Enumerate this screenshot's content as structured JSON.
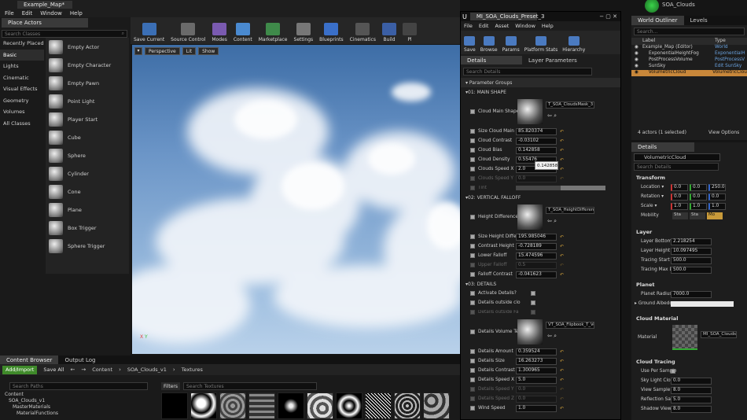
{
  "main_menu": [
    "File",
    "Edit",
    "Window",
    "Help"
  ],
  "doc_tab": "Example_Map*",
  "place_actors": {
    "tab": "Place Actors",
    "search_placeholder": "Search Classes",
    "categories": [
      "Recently Placed",
      "Basic",
      "Lights",
      "Cinematic",
      "Visual Effects",
      "Geometry",
      "Volumes",
      "All Classes"
    ],
    "selected_category": "Basic",
    "items": [
      "Empty Actor",
      "Empty Character",
      "Empty Pawn",
      "Point Light",
      "Player Start",
      "Cube",
      "Sphere",
      "Cylinder",
      "Cone",
      "Plane",
      "Box Trigger",
      "Sphere Trigger"
    ]
  },
  "toolbar": [
    "Save Current",
    "Source Control",
    "Modes",
    "Content",
    "Marketplace",
    "Settings",
    "Blueprints",
    "Cinematics",
    "Build",
    "Pl"
  ],
  "viewport": {
    "perspective": "Perspective",
    "lit": "Lit",
    "show": "Show",
    "axis_x": "X",
    "axis_y": "Y"
  },
  "content_browser": {
    "tabs": [
      "Content Browser",
      "Output Log"
    ],
    "add_import": "Add/Import",
    "save_all": "Save All",
    "path": [
      "Content",
      "SOA_Clouds_v1",
      "Textures"
    ],
    "search_paths": "Search Paths",
    "filters": "Filters",
    "search_textures": "Search Textures",
    "tree": [
      "Content",
      "SOA_Clouds_v1",
      "MasterMaterials",
      "MaterialFunctions"
    ]
  },
  "material_editor": {
    "tab": "MI_SOA_Clouds_Preset_3",
    "menu": [
      "File",
      "Edit",
      "Asset",
      "Window",
      "Help"
    ],
    "tools": [
      "Save",
      "Browse",
      "Params",
      "Platform Stats",
      "Hierarchy"
    ],
    "subtabs": [
      "Details",
      "Layer Parameters"
    ],
    "search": "Search Details",
    "parameter_groups": "Parameter Groups",
    "groups": [
      {
        "title": "01: MAIN SHAPE",
        "rows": [
          {
            "label": "Cloud Main Shape",
            "tex": "T_SOA_CloudsMask_3",
            "kind": "tex"
          },
          {
            "label": "Size Cloud Main S",
            "value": "85.820374"
          },
          {
            "label": "Cloud Contrast",
            "value": "-0.03102"
          },
          {
            "label": "Cloud Bias",
            "value": "0.142858"
          },
          {
            "label": "Cloud Density",
            "value": "0.55476"
          },
          {
            "label": "Clouds Speed X",
            "value": "2.0"
          },
          {
            "label": "Clouds Speed Y",
            "value": "0.0",
            "off": true
          },
          {
            "label": "Tint",
            "kind": "tint",
            "off": true
          }
        ]
      },
      {
        "title": "02: VERTICAL FALLOFF",
        "rows": [
          {
            "label": "Height Difference",
            "tex": "T_SOA_HeightDifference_1",
            "kind": "tex"
          },
          {
            "label": "Size Height Differ",
            "value": "195.985046"
          },
          {
            "label": "Contrast Height Di",
            "value": "-0.728189"
          },
          {
            "label": "Lower Falloff",
            "value": "15.474596"
          },
          {
            "label": "Upper Falloff",
            "value": "0.5",
            "off": true
          },
          {
            "label": "Falloff Contrast",
            "value": "-0.041623"
          }
        ]
      },
      {
        "title": "03: DETAILS",
        "rows": [
          {
            "label": "Activate Details?",
            "kind": "bool"
          },
          {
            "label": "Details outside clo",
            "kind": "bool"
          },
          {
            "label": "Details outside Fa",
            "kind": "bool",
            "off": true
          },
          {
            "label": "Details Volume Te",
            "tex": "VT_SOA_Flipbook_T_Volum",
            "kind": "tex"
          },
          {
            "label": "Details Amount",
            "value": "0.359524"
          },
          {
            "label": "Details Size",
            "value": "16.263273"
          },
          {
            "label": "Details Contrast",
            "value": "1.300965"
          },
          {
            "label": "Details Speed X",
            "value": "5.0"
          },
          {
            "label": "Details Speed Y",
            "value": "0.0",
            "off": true
          },
          {
            "label": "Details Speed Z",
            "value": "0.0",
            "off": true
          },
          {
            "label": "Wind Speed",
            "value": "1.0"
          }
        ]
      }
    ],
    "tooltip": "0.142858"
  },
  "user": "SOA_Clouds",
  "world_outliner": {
    "tabs": [
      "World Outliner",
      "Levels"
    ],
    "search": "Search...",
    "col_label": "Label",
    "col_type": "Type",
    "rows": [
      {
        "label": "Example_Map (Editor)",
        "type": "World"
      },
      {
        "label": "ExponentialHeightFog",
        "type": "ExponentialH"
      },
      {
        "label": "PostProcessVolume",
        "type": "PostProcessV"
      },
      {
        "label": "SunSky",
        "type": "Edit SunSky"
      },
      {
        "label": "VolumetricCloud",
        "type": "VolumetricClou"
      }
    ],
    "status": "4 actors (1 selected)",
    "view_options": "View Options"
  },
  "details": {
    "tab": "Details",
    "name": "VolumetricCloud",
    "search": "Search Details",
    "transform": "Transform",
    "location": [
      "0.0",
      "0.0",
      "250.0"
    ],
    "rotation": [
      "0.0",
      "0.0",
      "0.0"
    ],
    "scale": [
      "1.0",
      "1.0",
      "1.0"
    ],
    "mobility": [
      "Sta",
      "Sta",
      "Mo"
    ],
    "layer": "Layer",
    "layer_rows": [
      {
        "label": "Layer Bottom Al",
        "value": "2.218254"
      },
      {
        "label": "Layer Height",
        "value": "10.097495"
      },
      {
        "label": "Tracing Start M",
        "value": "500.0"
      },
      {
        "label": "Tracing Max Dis",
        "value": "500.0"
      }
    ],
    "planet": "Planet",
    "planet_radius": "7000.0",
    "ground_albedo": "Ground Albedo",
    "cloud_material": "Cloud Material",
    "material_label": "Material",
    "material_value": "MI_SOA_Clouds",
    "cloud_tracing": "Cloud Tracing",
    "tracing_rows": [
      {
        "label": "Use Per Sample",
        "value": ""
      },
      {
        "label": "Sky Light Cloud",
        "value": "0.0"
      },
      {
        "label": "View Sample Co",
        "value": "8.0"
      },
      {
        "label": "Reflection Samp",
        "value": "5.0"
      },
      {
        "label": "Shadow View Sa",
        "value": "8.0"
      }
    ]
  }
}
